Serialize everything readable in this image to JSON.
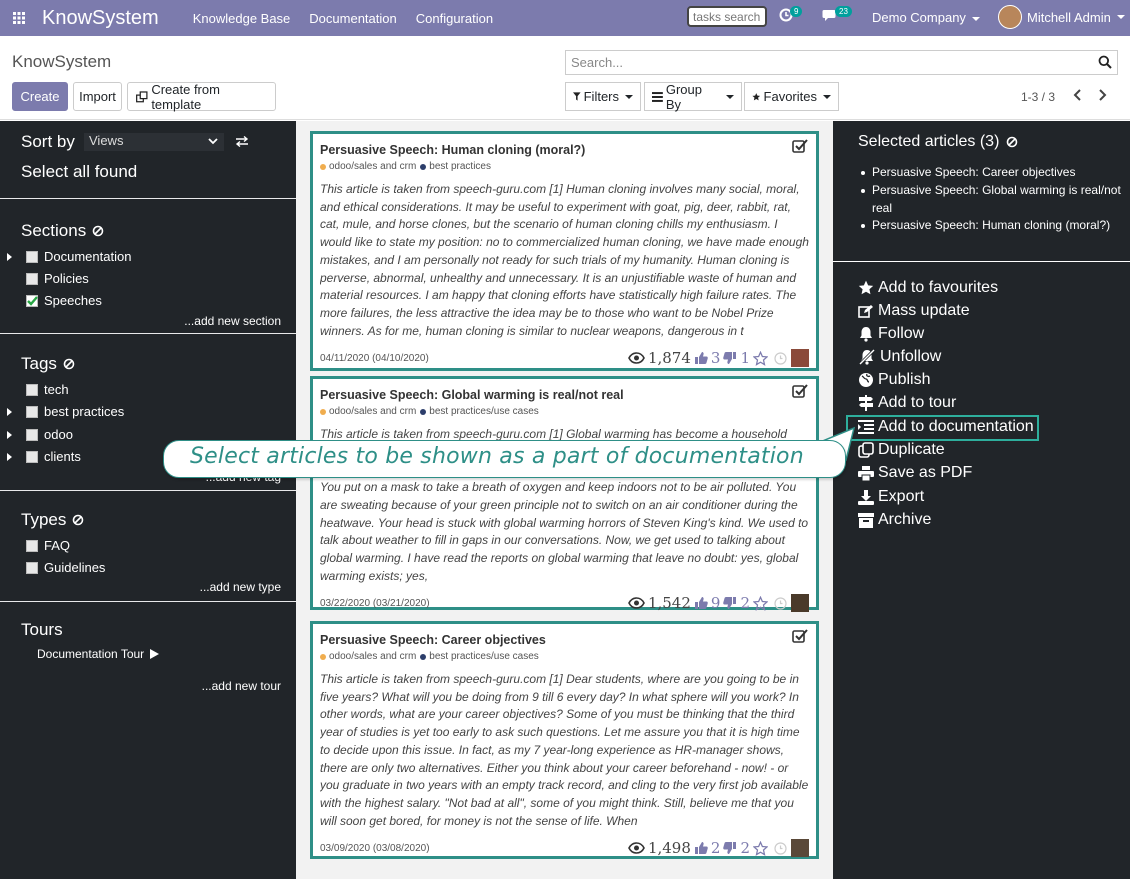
{
  "topbar": {
    "brand": "KnowSystem",
    "menu": [
      "Knowledge Base",
      "Documentation",
      "Configuration"
    ],
    "tasks_search_placeholder": "tasks search",
    "activity_count": "9",
    "messages_count": "23",
    "company": "Demo Company",
    "user": "Mitchell Admin"
  },
  "control_panel": {
    "breadcrumb": "KnowSystem",
    "create_label": "Create",
    "import_label": "Import",
    "template_label": "Create from template",
    "search_placeholder": "Search...",
    "filters_label": "Filters",
    "groupby_label": "Group By",
    "favorites_label": "Favorites",
    "pager": "1-3 / 3"
  },
  "left_panel": {
    "sort_label": "Sort by",
    "sort_value": "Views",
    "select_all": "Select all found",
    "sections_title": "Sections",
    "sections": [
      {
        "label": "Documentation",
        "expandable": true,
        "checked": false
      },
      {
        "label": "Policies",
        "expandable": false,
        "checked": false
      },
      {
        "label": "Speeches",
        "expandable": false,
        "checked": true
      }
    ],
    "add_section": "...add new section",
    "tags_title": "Tags",
    "tags": [
      {
        "label": "tech",
        "expandable": false
      },
      {
        "label": "best practices",
        "expandable": true
      },
      {
        "label": "odoo",
        "expandable": true
      },
      {
        "label": "clients",
        "expandable": true
      }
    ],
    "add_tag": "...add new tag",
    "types_title": "Types",
    "types": [
      "FAQ",
      "Guidelines"
    ],
    "add_type": "...add new type",
    "tours_title": "Tours",
    "tours": [
      "Documentation Tour"
    ],
    "add_tour": "...add new tour"
  },
  "articles": [
    {
      "title": "Persuasive Speech: Human cloning (moral?)",
      "tag1": "odoo/sales and crm",
      "tag2": "best practices",
      "excerpt": "This article is taken from  speech-guru.com [1] Human cloning involves many social, moral, and ethical considerations. It may be useful to experiment with goat, pig, deer, rabbit, rat, cat, mule, and horse clones, but the scenario of human cloning chills my enthusiasm. I would like to state my position: no to commercialized human cloning, we have made enough mistakes, and I am personally not ready for such trials of my humanity. Human cloning is perverse, abnormal, unhealthy and unnecessary. It is an unjustifiable waste of human and material resources. I am happy that cloning efforts have statistically high failure rates. The more failures, the less attractive the idea may be to those who want to be Nobel Prize winners. As for me, human cloning is similar to nuclear weapons, dangerous in t",
      "date": "04/11/2020 (04/10/2020)",
      "views": "1,874",
      "likes": "3",
      "dislikes": "1"
    },
    {
      "title": "Persuasive Speech: Global warming is real/not real",
      "tag1": "odoo/sales and crm",
      "tag2": "best practices/use cases",
      "excerpt": "This article is taken from  speech-guru.com [1] Global warming has become a household word. Scientists, politicians and ordinary people talk about global warming with concern. Imagine yourself walking outside the ozone hole in the dense smog of greenhouse gases. You put on a mask to take a breath of oxygen and keep indoors not to be air polluted. You are sweating because of your green principle not to switch on an air conditioner during the heatwave. Your head is stuck with global warming horrors of Steven King's kind. We used to talk about weather to fill in gaps in our conversations. Now, we get used to talking about global warming. I have read the reports on global warming that leave no doubt: yes, global warming exists; yes,",
      "date": "03/22/2020 (03/21/2020)",
      "views": "1,542",
      "likes": "9",
      "dislikes": "2"
    },
    {
      "title": "Persuasive Speech: Career objectives",
      "tag1": "odoo/sales and crm",
      "tag2": "best practices/use cases",
      "excerpt": "This article is taken from  speech-guru.com [1] Dear students, where are you going to be in five years? What will you be doing from 9 till 6 every day? In what sphere will you work? In other words, what are your career objectives? Some of you must be thinking that the third year of studies is yet too early to ask such questions. Let me assure you that it is high time to decide upon this issue. In fact, as my 7 year-long experience as HR-manager shows, there are only two alternatives. Either you think about your career beforehand - now! - or you graduate in two years with an empty track record, and cling to the very first job available with the highest salary. \"Not bad at all\", some of you might think. Still, believe me that you will soon get bored, for money is not the sense of life. When",
      "date": "03/09/2020 (03/08/2020)",
      "views": "1,498",
      "likes": "2",
      "dislikes": "2"
    }
  ],
  "right_panel": {
    "selected_title": "Selected articles (3)",
    "selected": [
      "Persuasive Speech: Career objectives",
      "Persuasive Speech: Global warming is real/not real",
      "Persuasive Speech: Human cloning (moral?)"
    ],
    "actions": [
      {
        "label": "Add to favourites",
        "icon": "star-icon"
      },
      {
        "label": "Mass update",
        "icon": "edit-icon"
      },
      {
        "label": "Follow",
        "icon": "bell-icon"
      },
      {
        "label": "Unfollow",
        "icon": "bell-slash-icon"
      },
      {
        "label": "Publish",
        "icon": "globe-icon"
      },
      {
        "label": "Add to tour",
        "icon": "signpost-icon"
      },
      {
        "label": "Add to documentation",
        "icon": "list-indent-icon"
      },
      {
        "label": "Duplicate",
        "icon": "copy-icon"
      },
      {
        "label": "Save as PDF",
        "icon": "print-icon"
      },
      {
        "label": "Export",
        "icon": "download-icon"
      },
      {
        "label": "Archive",
        "icon": "archive-icon"
      }
    ]
  },
  "callout": "Select articles to be shown as a part of documentation",
  "colors": {
    "brand": "#7c7bad",
    "panel": "#212529",
    "accent": "#2e8f87",
    "tag_dot_1": "#f0ad4e",
    "tag_dot_2": "#2c3e6b"
  }
}
